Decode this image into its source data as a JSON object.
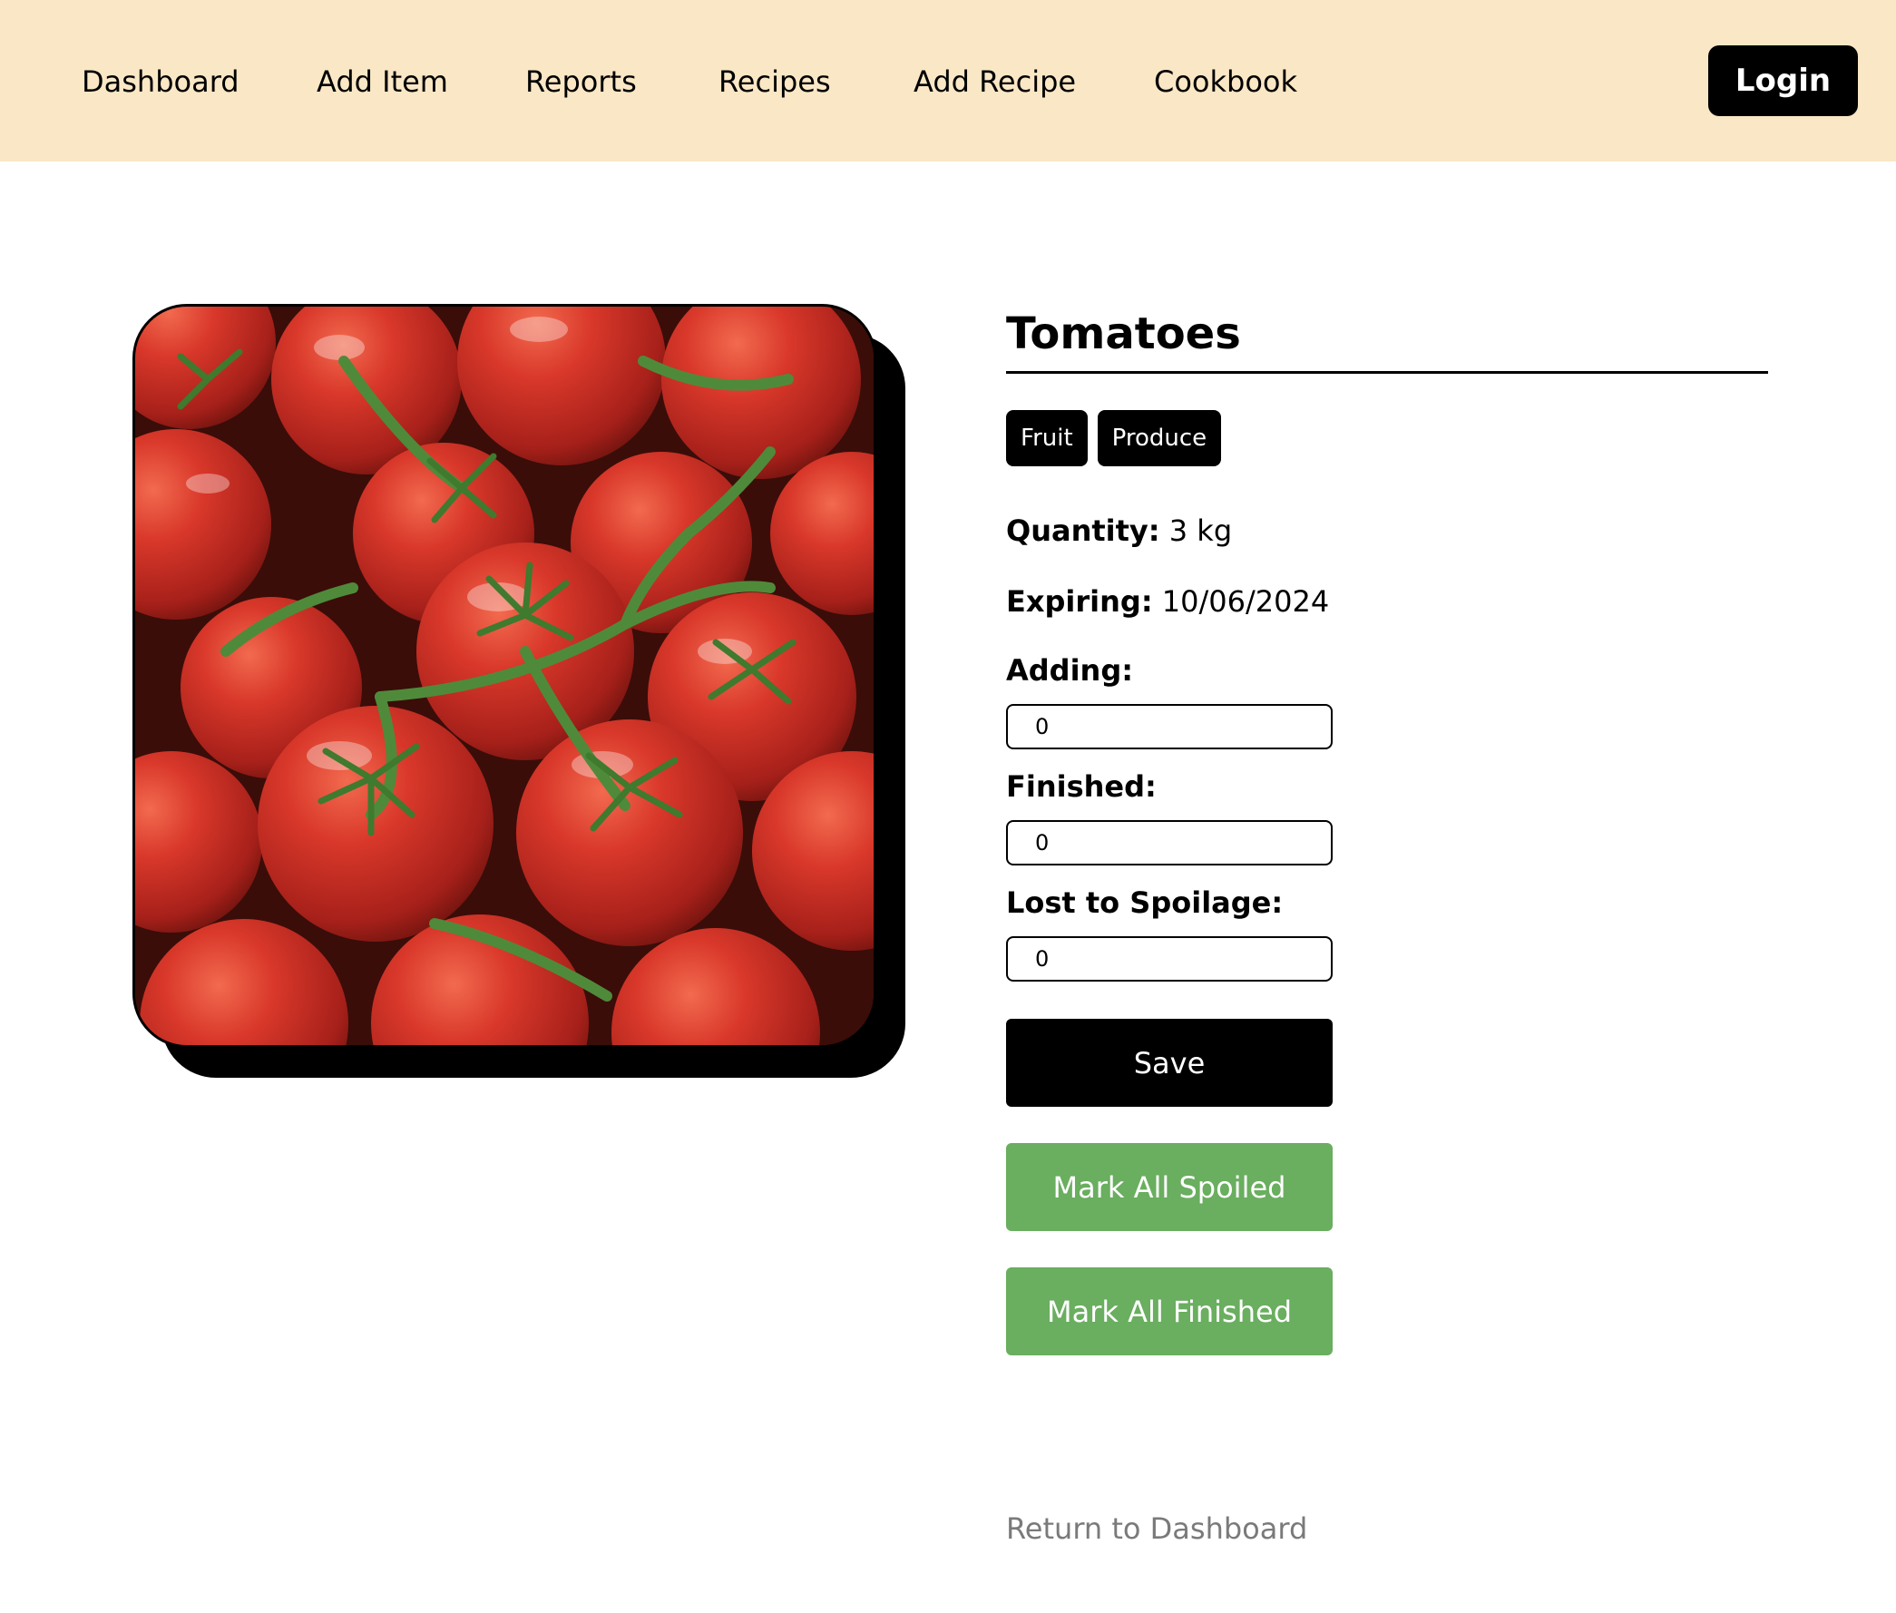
{
  "nav": {
    "links": [
      "Dashboard",
      "Add Item",
      "Reports",
      "Recipes",
      "Add Recipe",
      "Cookbook"
    ],
    "login_label": "Login"
  },
  "item": {
    "title": "Tomatoes",
    "tags": [
      "Fruit",
      "Produce"
    ],
    "quantity_label": "Quantity:",
    "quantity_value": "3 kg",
    "expiring_label": "Expiring:",
    "expiring_value": "10/06/2024",
    "image": "tomatoes-photo"
  },
  "form": {
    "adding_label": "Adding:",
    "adding_value": "0",
    "finished_label": "Finished:",
    "finished_value": "0",
    "spoilage_label": "Lost to Spoilage:",
    "spoilage_value": "0",
    "save_label": "Save",
    "mark_spoiled_label": "Mark All Spoiled",
    "mark_finished_label": "Mark All Finished"
  },
  "footer": {
    "return_label": "Return to Dashboard"
  },
  "colors": {
    "navbar_bg": "#fae7c5",
    "green_button": "#6aae5f",
    "muted_link": "#7a7a7a"
  }
}
